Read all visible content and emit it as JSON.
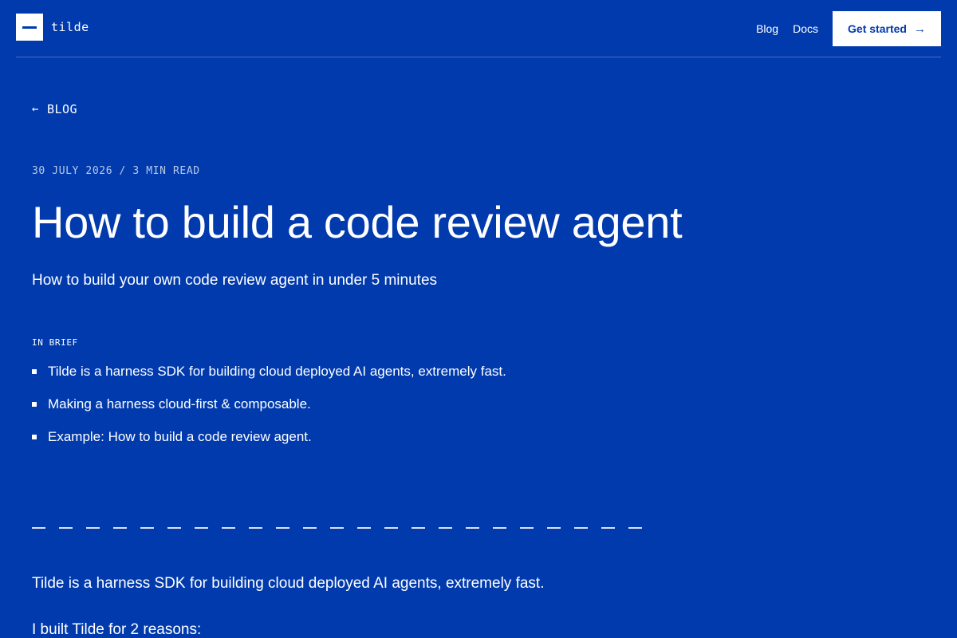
{
  "header": {
    "logo_text": "tilde",
    "nav": {
      "blog": "Blog",
      "docs": "Docs",
      "cta": "Get started",
      "cta_arrow": "→"
    }
  },
  "back_link": {
    "arrow": "←",
    "label": "BLOG"
  },
  "article": {
    "meta": "30 JULY 2026 / 3 MIN READ",
    "title": "How to build a code review agent",
    "subtitle": "How to build your own code review agent in under 5 minutes",
    "brief_label": "IN BRIEF",
    "brief_items": [
      "Tilde is a harness SDK for building cloud deployed AI agents, extremely fast.",
      "Making a harness cloud-first & composable.",
      "Example: How to build a code review agent."
    ],
    "paragraphs": [
      "Tilde is a harness SDK for building cloud deployed AI agents, extremely fast.",
      "I built Tilde for 2 reasons:"
    ]
  },
  "colors": {
    "background": "#003aad",
    "text": "#ffffff",
    "cta_background": "#ffffff",
    "cta_text": "#003aad"
  }
}
